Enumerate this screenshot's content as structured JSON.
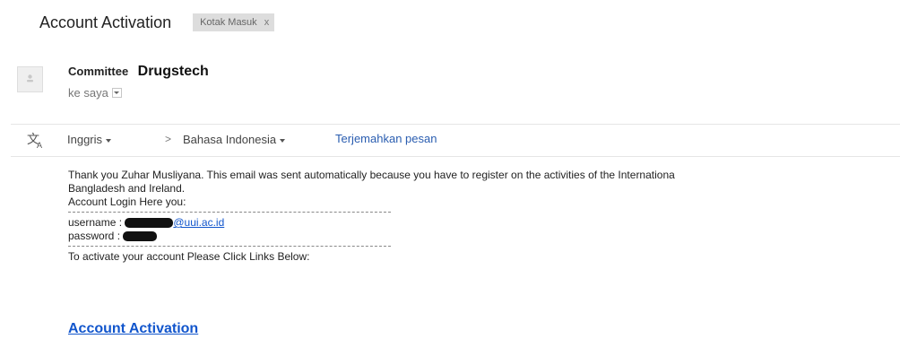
{
  "email": {
    "subject": "Account Activation",
    "label": {
      "text": "Kotak Masuk",
      "remove": "x"
    },
    "sender": {
      "first": "Committee",
      "last": "Drugstech"
    },
    "recipient": "ke saya"
  },
  "translate_bar": {
    "source_language": "Inggris",
    "arrow": ">",
    "target_language": "Bahasa Indonesia",
    "action": "Terjemahkan pesan",
    "icon": "translate-icon"
  },
  "message": {
    "line1": "Thank you Zuhar Musliyana. This email was sent automatically because you have to register on the activities of the Internationa",
    "line2": "Bangladesh and Ireland.",
    "line3": "Account Login Here you:",
    "username_label": "username :",
    "username_domain": "@uui.ac.id",
    "password_label": "password :",
    "activate_prompt": "To activate your account Please Click Links Below:",
    "activation_link": "Account Activation"
  },
  "colors": {
    "link": "#1155cc",
    "translate_link": "#2a5db0",
    "label_chip": "#dddddd"
  }
}
